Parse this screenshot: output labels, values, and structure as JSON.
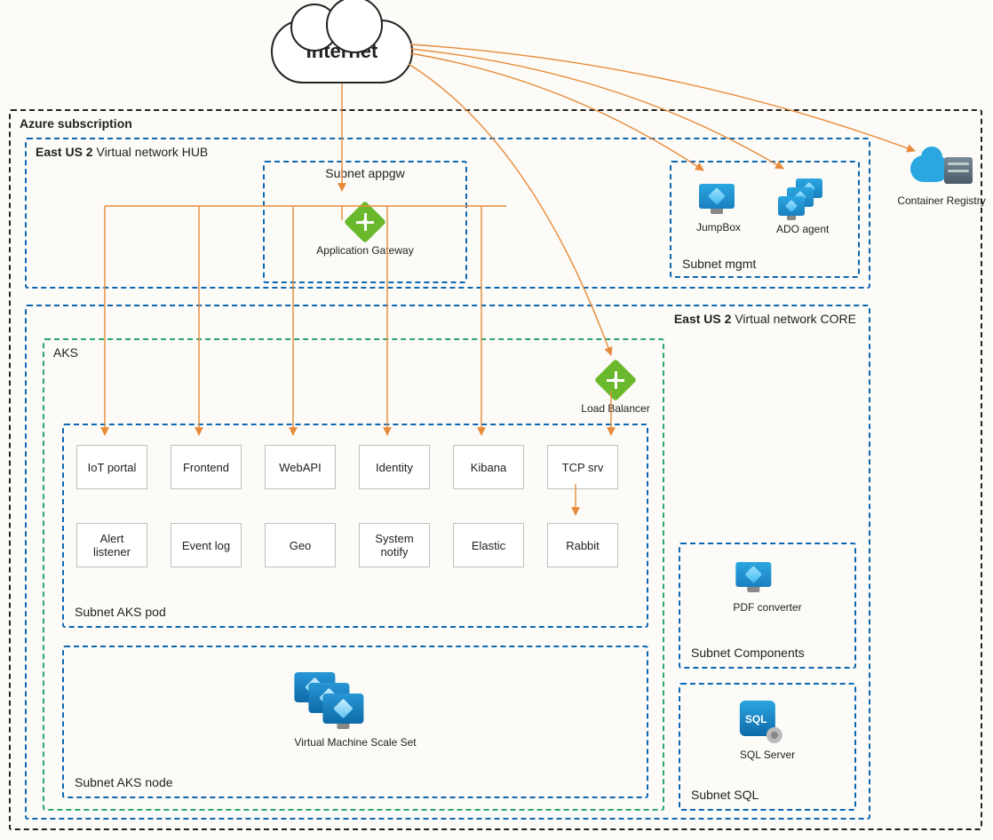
{
  "internet": {
    "label": "Internet"
  },
  "subscription": {
    "title": "Azure subscription"
  },
  "hub": {
    "title_region": "East US 2",
    "title": "Virtual network HUB",
    "appgw_subnet": {
      "label": "Subnet appgw",
      "gateway_label": "Application Gateway"
    },
    "mgmt_subnet": {
      "label": "Subnet mgmt",
      "jumpbox_label": "JumpBox",
      "ado_label": "ADO agent"
    }
  },
  "core": {
    "title_region": "East US 2",
    "title": "Virtual network CORE",
    "aks": {
      "label": "AKS",
      "load_balancer_label": "Load Balancer"
    },
    "pods": {
      "subnet_label": "Subnet AKS pod",
      "items": [
        "IoT portal",
        "Frontend",
        "WebAPI",
        "Identity",
        "Kibana",
        "TCP srv",
        "Alert listener",
        "Event log",
        "Geo",
        "System notify",
        "Elastic",
        "Rabbit"
      ]
    },
    "nodes": {
      "subnet_label": "Subnet AKS node",
      "vmss_label": "Virtual Machine Scale Set"
    },
    "components": {
      "subnet_label": "Subnet Components",
      "pdf_label": "PDF converter"
    },
    "sql": {
      "subnet_label": "Subnet SQL",
      "server_label": "SQL Server"
    }
  },
  "registry": {
    "label": "Container Registry"
  }
}
